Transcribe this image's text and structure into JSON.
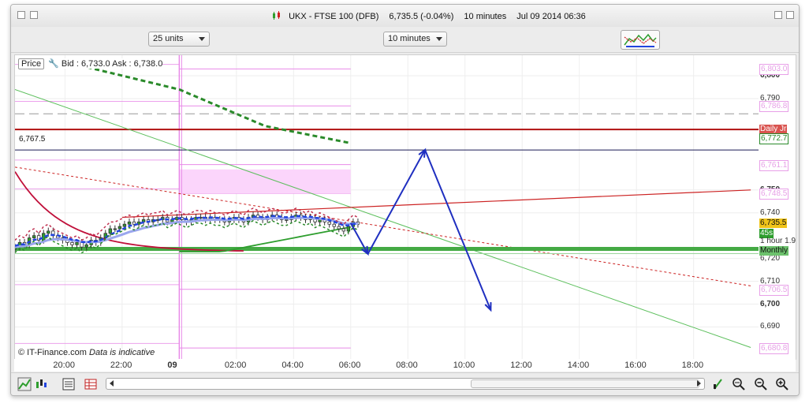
{
  "window": {
    "instrument": "UKX - FTSE 100 (DFB)",
    "price_change": "6,735.5 (-0.04%)",
    "interval": "10 minutes",
    "datetime": "Jul 09 2014 06:36"
  },
  "toolbar": {
    "units_select": "25 units",
    "interval_select": "10 minutes"
  },
  "price_header": {
    "label": "Price",
    "bid_ask": "Bid : 6,733.0  Ask : 6,738.0"
  },
  "level_line_label": "6,767.5",
  "copyright": "© IT-Finance.com",
  "disclaimer": "Data is indicative",
  "y_axis": {
    "ticks": [
      {
        "label": "6,800",
        "value": 6800,
        "bold": true
      },
      {
        "label": "6,790",
        "value": 6790,
        "bold": false
      },
      {
        "label": "6,750",
        "value": 6750,
        "bold": true
      },
      {
        "label": "6,740",
        "value": 6740,
        "bold": false
      },
      {
        "label": "6,720",
        "value": 6720,
        "bold": false
      },
      {
        "label": "6,710",
        "value": 6710,
        "bold": false
      },
      {
        "label": "6,700",
        "value": 6700,
        "bold": true
      },
      {
        "label": "6,690",
        "value": 6690,
        "bold": false
      }
    ],
    "pivot_labels": [
      {
        "label": "6,803.0",
        "value": 6803.0
      },
      {
        "label": "6,786.8",
        "value": 6786.8
      },
      {
        "label": "6,761.1",
        "value": 6761.1
      },
      {
        "label": "6,748.5",
        "value": 6748.5
      },
      {
        "label": "6,706.5",
        "value": 6706.5
      },
      {
        "label": "6,680.8",
        "value": 6680.8
      }
    ],
    "daily_label": "Daily",
    "daily_suffix": "Jr",
    "daily_value": 6776.5,
    "ma_value_label": "6,772.7",
    "ma_value": 6772.7,
    "current_price_label": "6,735.5",
    "current_price": 6735.5,
    "countdown": "45s",
    "hour_label": "1 hour",
    "hour_suffix": "1.9",
    "monthly_label": "Monthly",
    "monthly_value": 6724.2
  },
  "x_axis": {
    "ticks": [
      {
        "label": "20:00",
        "hour": 20,
        "bold": false
      },
      {
        "label": "22:00",
        "hour": 22,
        "bold": false
      },
      {
        "label": "09",
        "hour": 24,
        "bold": true
      },
      {
        "label": "02:00",
        "hour": 26,
        "bold": false
      },
      {
        "label": "04:00",
        "hour": 28,
        "bold": false
      },
      {
        "label": "06:00",
        "hour": 30,
        "bold": false
      },
      {
        "label": "08:00",
        "hour": 32,
        "bold": false
      },
      {
        "label": "10:00",
        "hour": 34,
        "bold": false
      },
      {
        "label": "12:00",
        "hour": 36,
        "bold": false
      },
      {
        "label": "14:00",
        "hour": 38,
        "bold": false
      },
      {
        "label": "16:00",
        "hour": 40,
        "bold": false
      },
      {
        "label": "18:00",
        "hour": 42,
        "bold": false
      }
    ]
  },
  "colors": {
    "up": "#2e9e2e",
    "down": "#222222",
    "blue_ma": "#2244dd",
    "lightblue_ma": "#9aa6ee",
    "green_dotted": "#2a8a2a",
    "red_line": "#cc2222",
    "pink": "#e88ae8",
    "monthly": "#44aa44",
    "projection": "#1f2fc0"
  },
  "chart_data": {
    "type": "candlestick",
    "x_unit": "hours since Jul 08 00:00",
    "ylim": [
      6676,
      6809
    ],
    "xlim": [
      18.25,
      44.3
    ],
    "candles_start_hour": 18.25,
    "candle_step_hours": 0.1667,
    "candles_close": [
      6725,
      6727,
      6726,
      6729,
      6730,
      6728,
      6731,
      6732,
      6730,
      6729,
      6728,
      6727,
      6726,
      6727,
      6725,
      6726,
      6728,
      6727,
      6729,
      6731,
      6733,
      6733,
      6734,
      6735,
      6736,
      6735,
      6736,
      6737,
      6736,
      6737,
      6737,
      6738,
      6736,
      6737,
      6738,
      6737,
      6736,
      6737,
      6738,
      6738,
      6737,
      6738,
      6737,
      6737,
      6736,
      6737,
      6738,
      6737,
      6736,
      6738,
      6739,
      6738,
      6737,
      6738,
      6739,
      6738,
      6737,
      6737,
      6738,
      6739,
      6738,
      6737,
      6738,
      6736,
      6737,
      6736,
      6735,
      6734,
      6733,
      6732,
      6734,
      6736,
      6735
    ],
    "daily_pivots": [
      6803.0,
      6786.8,
      6761.1,
      6748.5,
      6706.5,
      6680.8
    ],
    "level_line": 6767.5,
    "current_price": 6735.5,
    "monthly_level": 6724.2,
    "projection_path": [
      [
        30.0,
        6735.5
      ],
      [
        30.6,
        6722
      ],
      [
        32.6,
        6767.6
      ],
      [
        34.9,
        6697.4
      ]
    ],
    "trend_green": [
      [
        18.25,
        6794
      ],
      [
        44.0,
        6681
      ]
    ],
    "trend_red_dotted": [
      [
        18.25,
        6760
      ],
      [
        44.0,
        6708
      ]
    ],
    "trend_red_solid": [
      [
        22.0,
        6738
      ],
      [
        44.0,
        6750
      ]
    ],
    "ema_green_dotted": [
      [
        19.7,
        6807
      ],
      [
        24.0,
        6794
      ],
      [
        27.0,
        6778
      ],
      [
        30.0,
        6770.5
      ]
    ]
  }
}
